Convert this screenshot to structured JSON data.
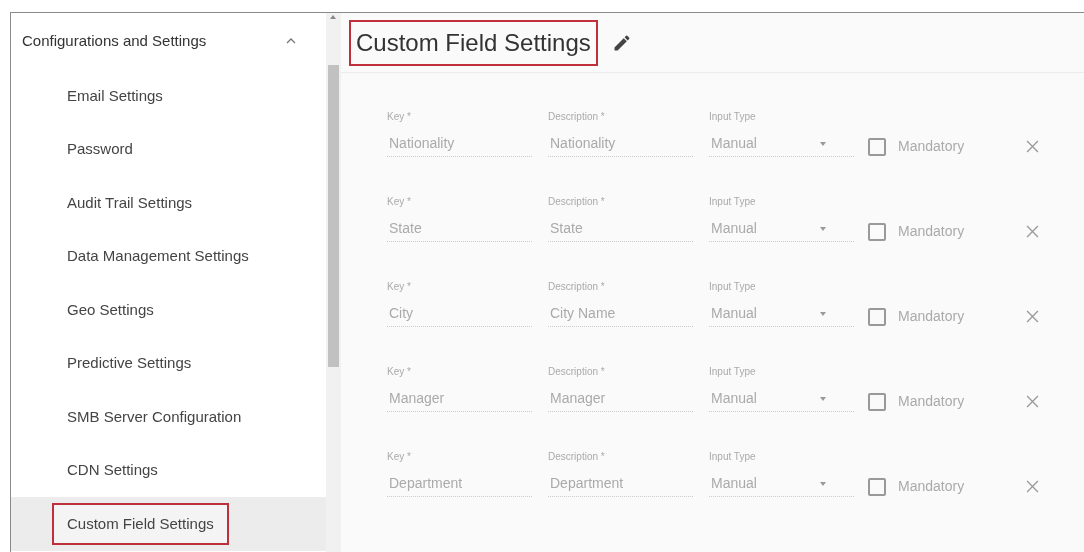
{
  "sidebar": {
    "section": {
      "label": "Configurations and Settings",
      "expanded": true
    },
    "items": [
      {
        "label": "Email Settings",
        "selected": false
      },
      {
        "label": "Password",
        "selected": false
      },
      {
        "label": "Audit Trail Settings",
        "selected": false
      },
      {
        "label": "Data Management Settings",
        "selected": false
      },
      {
        "label": "Geo Settings",
        "selected": false
      },
      {
        "label": "Predictive Settings",
        "selected": false
      },
      {
        "label": "SMB Server Configuration",
        "selected": false
      },
      {
        "label": "CDN Settings",
        "selected": false
      },
      {
        "label": "Custom Field Settings",
        "selected": true
      }
    ]
  },
  "page": {
    "title": "Custom Field Settings",
    "highlighted": true
  },
  "fields": [
    {
      "key_label": "Key *",
      "key": "Nationality",
      "description_label": "Description *",
      "description": "Nationality",
      "input_type_label": "Input Type",
      "input_type": "Manual",
      "mandatory_label": "Mandatory",
      "mandatory": false
    },
    {
      "key_label": "Key *",
      "key": "State",
      "description_label": "Description *",
      "description": "State",
      "input_type_label": "Input Type",
      "input_type": "Manual",
      "mandatory_label": "Mandatory",
      "mandatory": false
    },
    {
      "key_label": "Key *",
      "key": "City",
      "description_label": "Description *",
      "description": "City Name",
      "input_type_label": "Input Type",
      "input_type": "Manual",
      "mandatory_label": "Mandatory",
      "mandatory": false
    },
    {
      "key_label": "Key *",
      "key": "Manager",
      "description_label": "Description *",
      "description": "Manager",
      "input_type_label": "Input Type",
      "input_type": "Manual",
      "mandatory_label": "Mandatory",
      "mandatory": false
    },
    {
      "key_label": "Key *",
      "key": "Department",
      "description_label": "Description *",
      "description": "Department",
      "input_type_label": "Input Type",
      "input_type": "Manual",
      "mandatory_label": "Mandatory",
      "mandatory": false
    }
  ]
}
